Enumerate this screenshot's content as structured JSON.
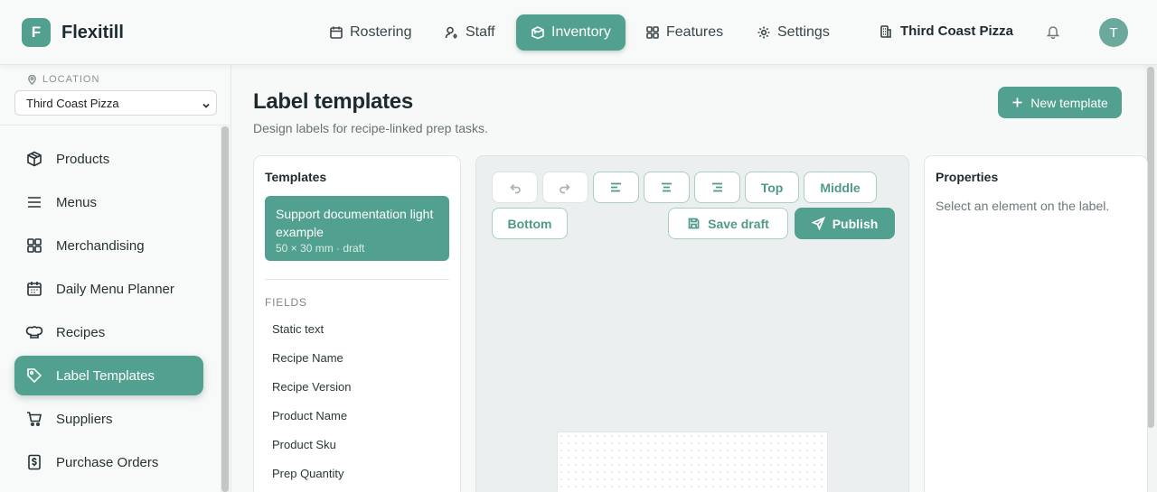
{
  "app": {
    "brand": "Flexitill",
    "logo_letter": "F",
    "accent": "#52a08f"
  },
  "nav": {
    "items": [
      {
        "label": "Rostering",
        "icon": "calendar-icon"
      },
      {
        "label": "Staff",
        "icon": "user-gear-icon"
      },
      {
        "label": "Inventory",
        "icon": "box-icon",
        "active": true
      },
      {
        "label": "Features",
        "icon": "grid-icon"
      },
      {
        "label": "Settings",
        "icon": "gear-icon"
      }
    ],
    "location": "Third Coast Pizza",
    "avatar_initial": "T"
  },
  "sidebar": {
    "location_label": "LOCATION",
    "location_value": "Third Coast Pizza",
    "items": [
      {
        "label": "Products",
        "icon": "package-icon"
      },
      {
        "label": "Menus",
        "icon": "list-icon"
      },
      {
        "label": "Merchandising",
        "icon": "grid-icon"
      },
      {
        "label": "Daily Menu Planner",
        "icon": "calendar-icon"
      },
      {
        "label": "Recipes",
        "icon": "chef-hat-icon"
      },
      {
        "label": "Label Templates",
        "icon": "tag-icon",
        "active": true
      },
      {
        "label": "Suppliers",
        "icon": "cart-icon"
      },
      {
        "label": "Purchase Orders",
        "icon": "dollar-doc-icon"
      }
    ]
  },
  "page": {
    "title": "Label templates",
    "subtitle": "Design labels for recipe-linked prep tasks.",
    "new_button": "New template"
  },
  "templates": {
    "title": "Templates",
    "selected": {
      "name": "Support documentation light example",
      "meta": "50 × 30 mm · draft"
    },
    "fields_label": "FIELDS",
    "fields": [
      "Static text",
      "Recipe Name",
      "Recipe Version",
      "Product Name",
      "Product Sku",
      "Prep Quantity"
    ]
  },
  "toolbar": {
    "top": "Top",
    "middle": "Middle",
    "bottom": "Bottom",
    "save_draft": "Save draft",
    "publish": "Publish"
  },
  "properties": {
    "title": "Properties",
    "empty": "Select an element on the label."
  }
}
